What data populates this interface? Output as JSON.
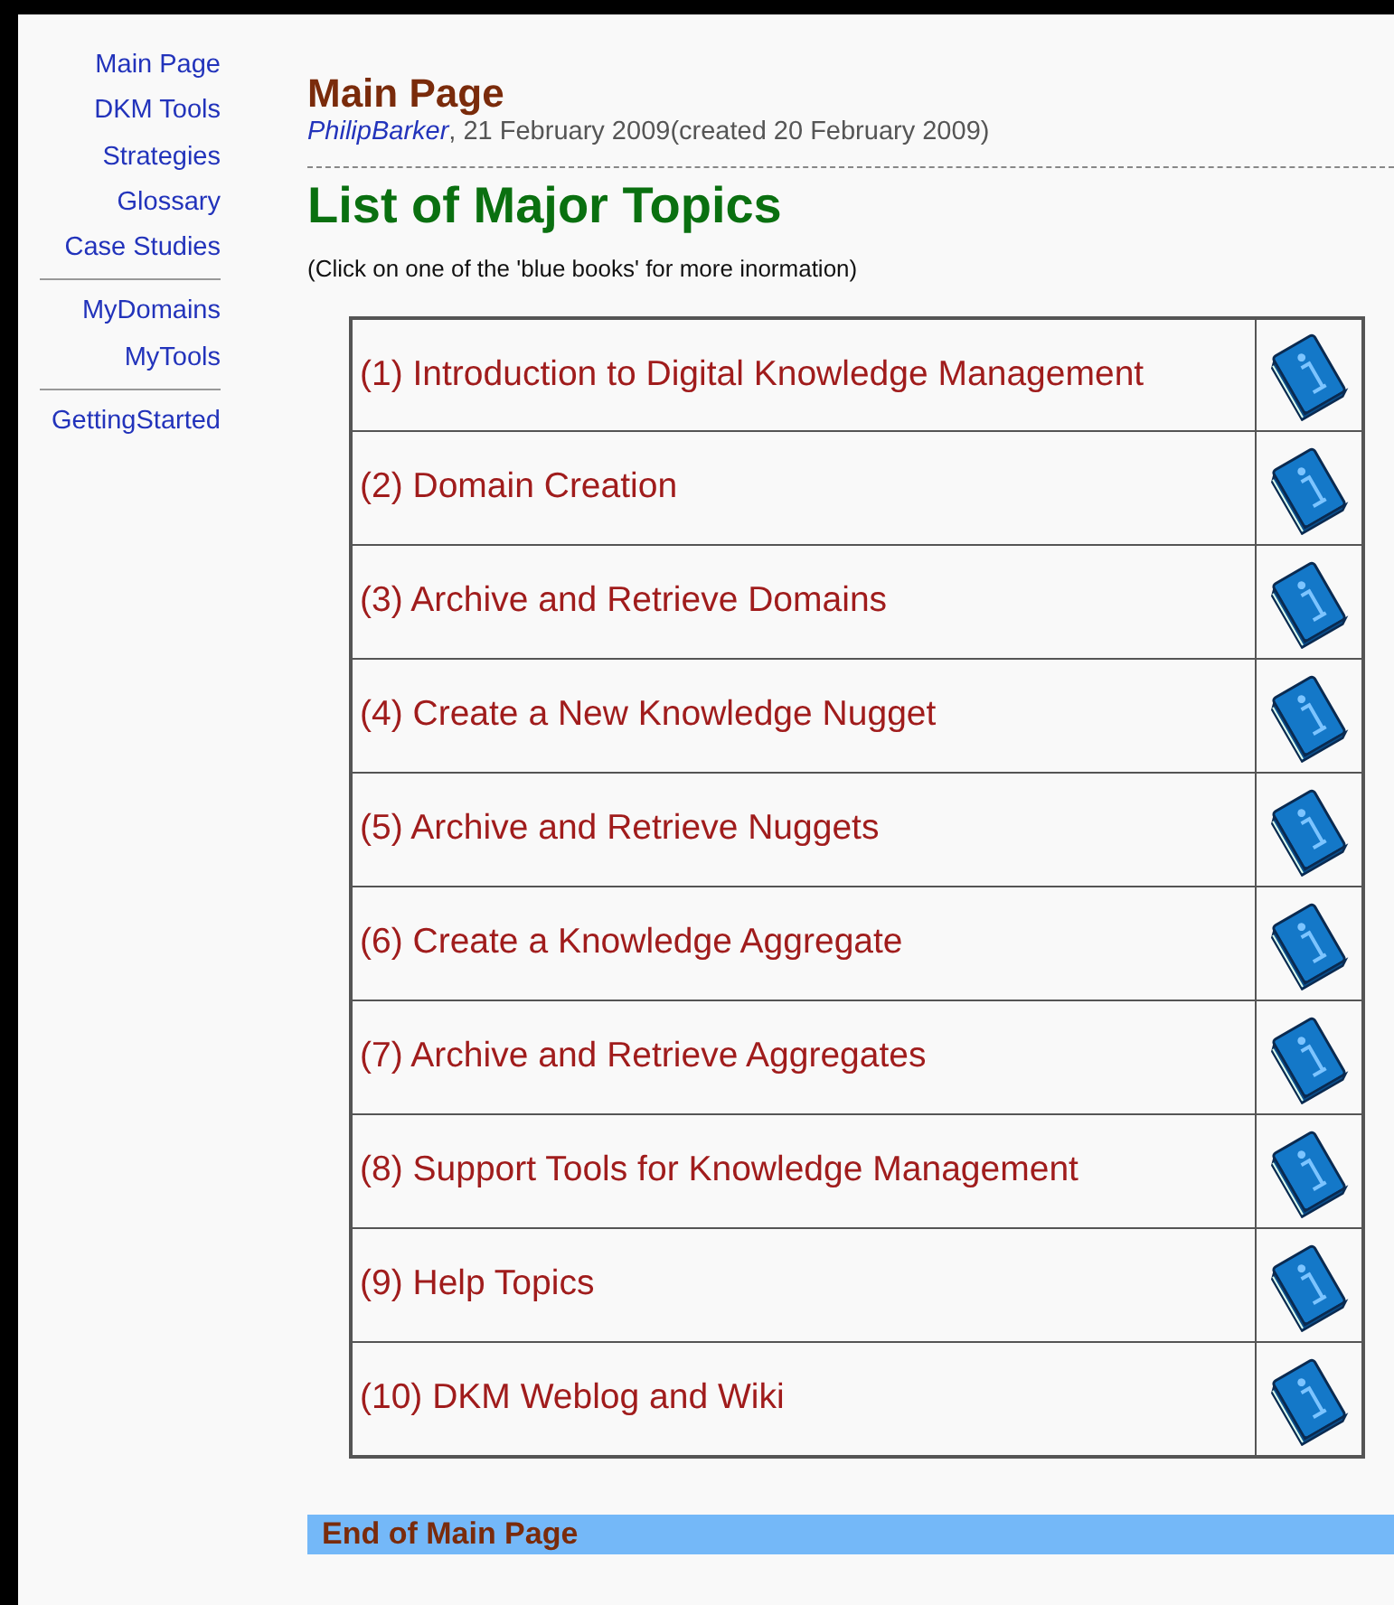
{
  "sidebar": {
    "groups": [
      {
        "items": [
          "Main Page",
          "DKM Tools",
          "Strategies",
          "Glossary",
          "Case Studies"
        ]
      },
      {
        "items": [
          "MyDomains",
          "MyTools"
        ]
      },
      {
        "items": [
          "GettingStarted"
        ]
      }
    ]
  },
  "page": {
    "title": "Main Page",
    "author": "PhilipBarker",
    "date": ", 21 February 2009(created 20 February 2009)"
  },
  "heading": "List of Major Topics",
  "hint": "(Click on one of the 'blue books' for more inormation)",
  "topics": [
    "(1) Introduction to Digital Knowledge Management",
    "(2) Domain Creation",
    "(3) Archive and Retrieve Domains",
    "(4) Create a New Knowledge Nugget",
    "(5) Archive and Retrieve Nuggets",
    "(6) Create a Knowledge Aggregate",
    "(7) Archive and Retrieve Aggregates",
    "(8) Support Tools for Knowledge Management",
    "(9) Help Topics",
    "(10) DKM Weblog and Wiki"
  ],
  "footer": "End of Main Page"
}
